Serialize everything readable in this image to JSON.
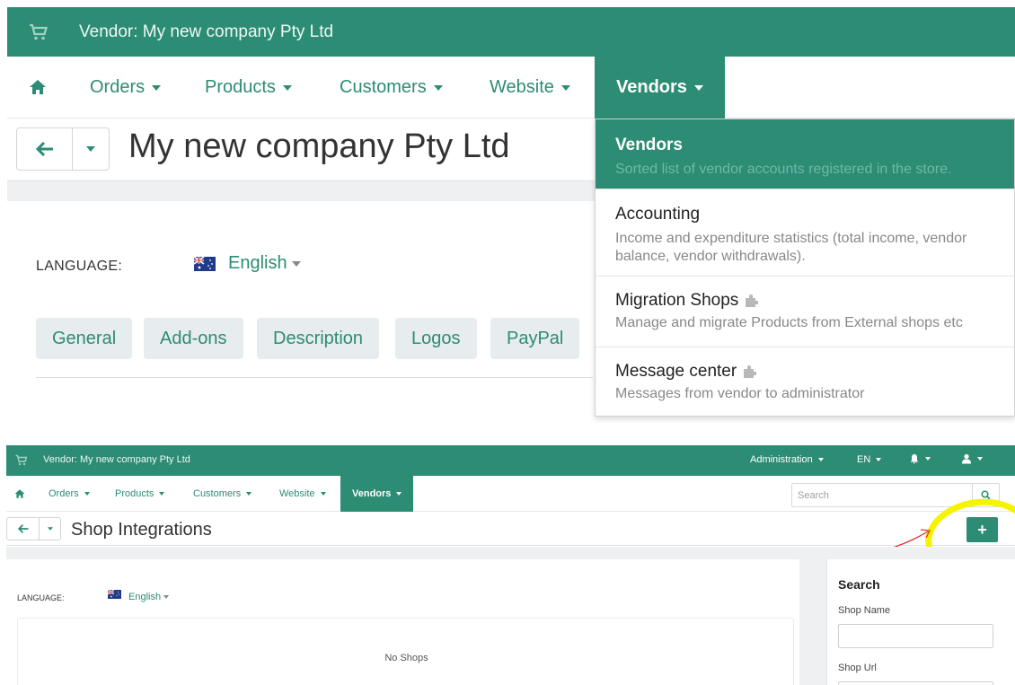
{
  "top": {
    "header_title": "Vendor: My new company Pty Ltd",
    "nav": {
      "home_icon": "home-icon",
      "items": [
        {
          "label": "Orders"
        },
        {
          "label": "Products"
        },
        {
          "label": "Customers"
        },
        {
          "label": "Website"
        },
        {
          "label": "Vendors"
        }
      ]
    },
    "page_title": "My new company Pty Ltd",
    "language_label": "LANGUAGE:",
    "language_value": "English",
    "tabs": [
      {
        "label": "General"
      },
      {
        "label": "Add-ons"
      },
      {
        "label": "Description"
      },
      {
        "label": "Logos"
      },
      {
        "label": "PayPal"
      }
    ],
    "vendors_menu": [
      {
        "title": "Vendors",
        "desc": "Sorted list of vendor accounts registered in the store."
      },
      {
        "title": "Accounting",
        "desc": "Income and expenditure statistics (total income, vendor balance, vendor withdrawals)."
      },
      {
        "title": "Migration Shops",
        "desc": "Manage and migrate Products from External shops etc"
      },
      {
        "title": "Message center",
        "desc": "Messages from vendor to administrator"
      }
    ],
    "highlight_color": "#f4f400"
  },
  "bottom": {
    "header_title": "Vendor: My new company Pty Ltd",
    "top_right": {
      "administration": "Administration",
      "language": "EN"
    },
    "nav": {
      "items": [
        {
          "label": "Orders"
        },
        {
          "label": "Products"
        },
        {
          "label": "Customers"
        },
        {
          "label": "Website"
        },
        {
          "label": "Vendors"
        }
      ]
    },
    "search_placeholder": "Search",
    "page_title": "Shop Integrations",
    "add_button": "+",
    "language_label": "LANGUAGE:",
    "language_value": "English",
    "empty_text": "No Shops",
    "sidebar": {
      "title": "Search",
      "shop_name_label": "Shop Name",
      "shop_url_label": "Shop Url"
    }
  },
  "colors": {
    "brand": "#2c8c74",
    "annotation_circle": "#f4f400",
    "annotation_arrow": "#e03030"
  }
}
